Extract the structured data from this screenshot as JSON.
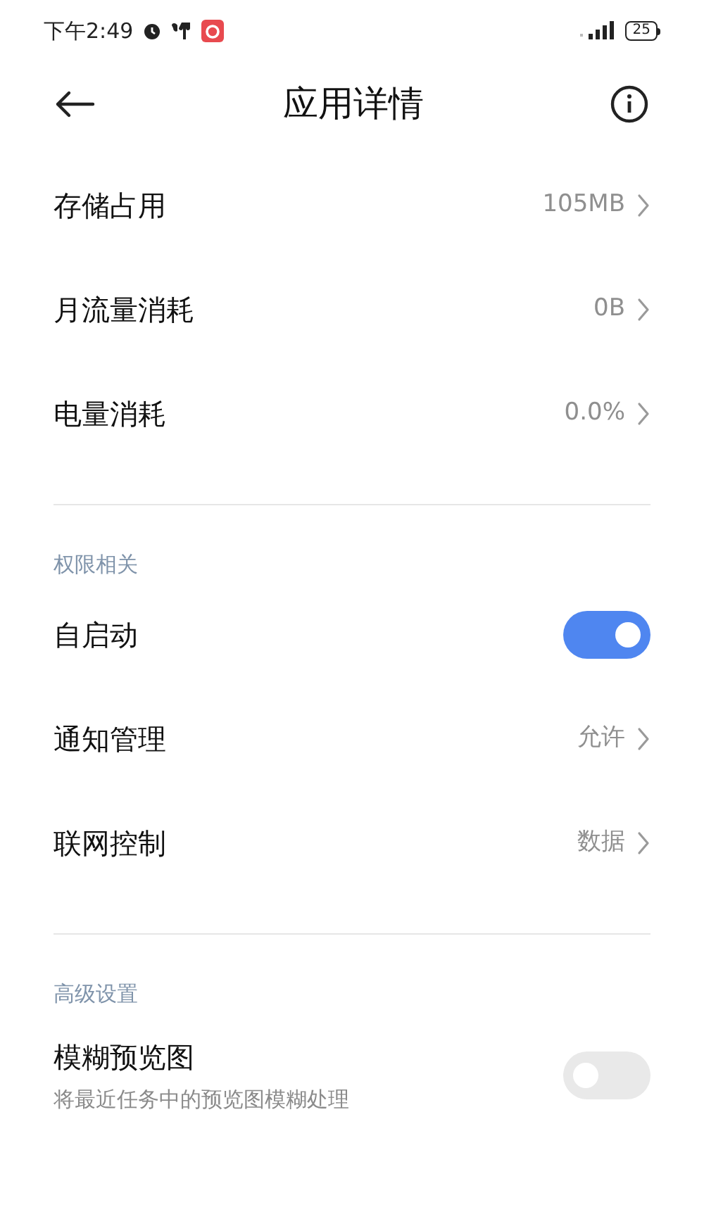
{
  "status_bar": {
    "time": "下午2:49",
    "battery": "25"
  },
  "header": {
    "title": "应用详情"
  },
  "sections": [
    {
      "items": [
        {
          "kind": "link",
          "label": "存储占用",
          "value": "105MB"
        },
        {
          "kind": "link",
          "label": "月流量消耗",
          "value": "0B"
        },
        {
          "kind": "link",
          "label": "电量消耗",
          "value": "0.0%"
        }
      ]
    },
    {
      "title": "权限相关",
      "items": [
        {
          "kind": "toggle",
          "label": "自启动",
          "on": true
        },
        {
          "kind": "link",
          "label": "通知管理",
          "value": "允许"
        },
        {
          "kind": "link",
          "label": "联网控制",
          "value": "数据"
        }
      ]
    },
    {
      "title": "高级设置",
      "items": [
        {
          "kind": "toggle",
          "label": "模糊预览图",
          "subtitle": "将最近任务中的预览图模糊处理",
          "on": false
        }
      ]
    }
  ]
}
